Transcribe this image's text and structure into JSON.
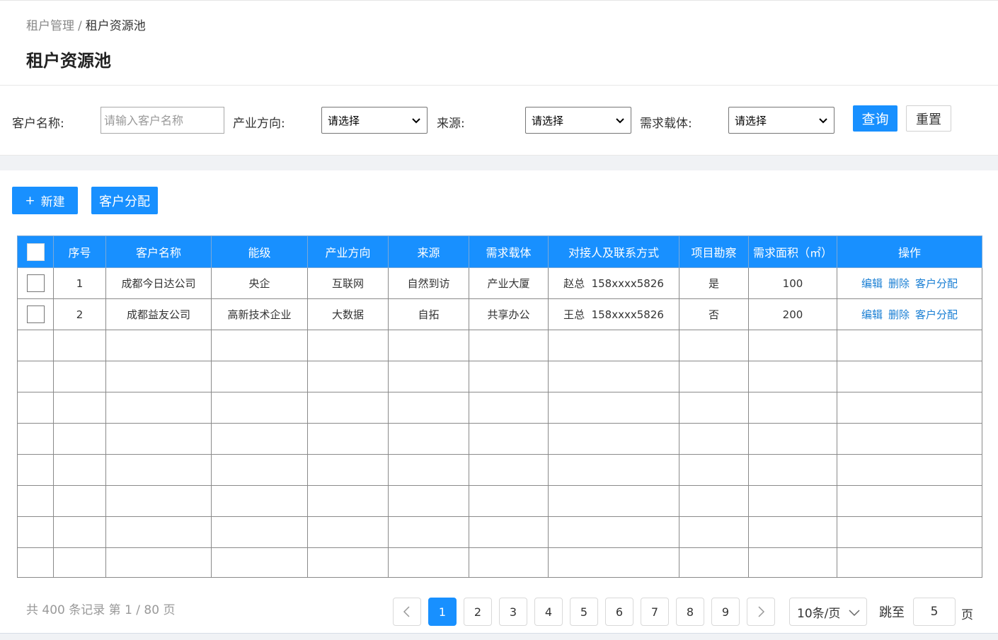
{
  "breadcrumb": {
    "parent": "租户管理",
    "separator": "/",
    "current": "租户资源池"
  },
  "page_title": "租户资源池",
  "filters": {
    "customer_name_label": "客户名称:",
    "customer_name_placeholder": "请输入客户名称",
    "industry_label": "产业方向:",
    "industry_value": "请选择",
    "source_label": "来源:",
    "source_value": "请选择",
    "carrier_label": "需求载体:",
    "carrier_value": "请选择",
    "query_label": "查询",
    "reset_label": "重置"
  },
  "actions": {
    "new_label": "新建",
    "new_icon": "+",
    "assign_label": "客户分配"
  },
  "table": {
    "headers": [
      "序号",
      "客户名称",
      "能级",
      "产业方向",
      "来源",
      "需求载体",
      "对接人及联系方式",
      "项目勘察",
      "需求面积（㎡）",
      "操作"
    ],
    "rows": [
      {
        "index": "1",
        "name": "成都今日达公司",
        "level": "央企",
        "industry": "互联网",
        "source": "自然到访",
        "carrier": "产业大厦",
        "contact": "赵总  158xxxx5826",
        "survey": "是",
        "area": "100"
      },
      {
        "index": "2",
        "name": "成都益友公司",
        "level": "高新技术企业",
        "industry": "大数据",
        "source": "自拓",
        "carrier": "共享办公",
        "contact": "王总  158xxxx5826",
        "survey": "否",
        "area": "200"
      }
    ],
    "row_actions": {
      "edit": "编辑",
      "delete": "删除",
      "assign": "客户分配"
    }
  },
  "pagination": {
    "summary": "共 400 条记录 第 1 / 80 页",
    "pages": [
      "1",
      "2",
      "3",
      "4",
      "5",
      "6",
      "7",
      "8",
      "9"
    ],
    "current_page": "1",
    "page_size": "10条/页",
    "jump_label": "跳至",
    "jump_value": "5",
    "page_unit": "页"
  },
  "colors": {
    "primary": "#1890ff",
    "link": "#1a7fd4",
    "band": "#f0f2f5"
  }
}
